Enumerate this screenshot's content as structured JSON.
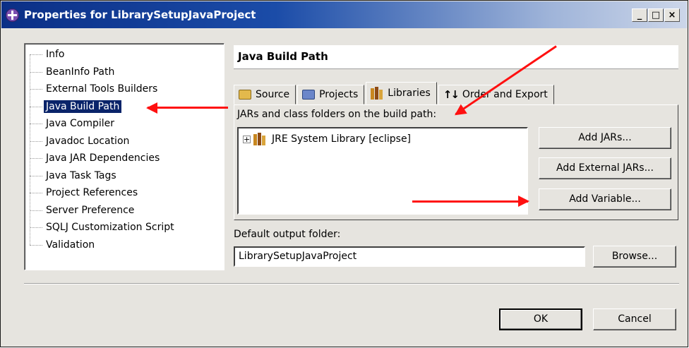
{
  "window": {
    "title": "Properties for LibrarySetupJavaProject",
    "controls": [
      "_",
      "□",
      "×"
    ]
  },
  "tree": {
    "items": [
      {
        "label": "Info"
      },
      {
        "label": "BeanInfo Path"
      },
      {
        "label": "External Tools Builders"
      },
      {
        "label": "Java Build Path",
        "selected": true
      },
      {
        "label": "Java Compiler"
      },
      {
        "label": "Javadoc Location"
      },
      {
        "label": "Java JAR Dependencies"
      },
      {
        "label": "Java Task Tags"
      },
      {
        "label": "Project References"
      },
      {
        "label": "Server Preference"
      },
      {
        "label": "SQLJ Customization Script"
      },
      {
        "label": "Validation"
      }
    ]
  },
  "page": {
    "title": "Java Build Path"
  },
  "tabs": [
    {
      "label": "Source",
      "icon": "folder-icon"
    },
    {
      "label": "Projects",
      "icon": "project-icon"
    },
    {
      "label": "Libraries",
      "icon": "books-icon",
      "active": true
    },
    {
      "label": "Order and Export",
      "icon": "order-icon"
    }
  ],
  "libraries": {
    "caption": "JARs and class folders on the build path:",
    "entries": [
      {
        "label": "JRE System Library [eclipse]",
        "expander": "+"
      }
    ],
    "buttons": {
      "add_jars": "Add JARs...",
      "add_external_jars": "Add External JARs...",
      "add_variable": "Add Variable..."
    }
  },
  "output": {
    "label": "Default output folder:",
    "value": "LibrarySetupJavaProject",
    "browse": "Browse..."
  },
  "footer": {
    "ok": "OK",
    "cancel": "Cancel"
  },
  "colors": {
    "annotation_arrow": "#ff1010",
    "selection": "#0a246a",
    "titlebar": "#0b2f86"
  }
}
